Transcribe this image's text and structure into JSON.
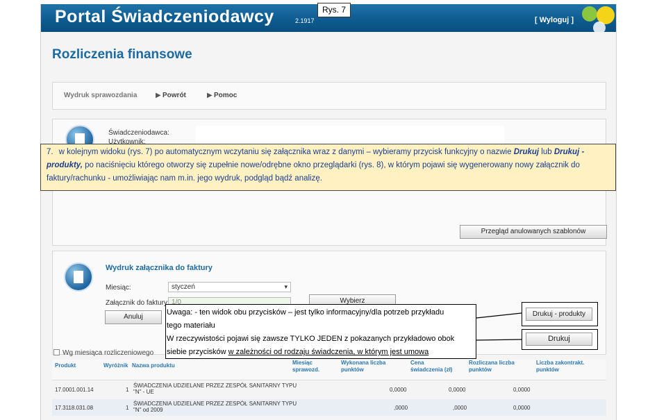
{
  "header": {
    "title": "Portal Świadczeniodawcy",
    "version": "2.1917",
    "logout": "[ Wyloguj ]",
    "brand_colors": [
      "#8ac640",
      "#f5d319",
      "#1f73a8"
    ]
  },
  "page": {
    "title": "Rozliczenia finansowe"
  },
  "toolbar": {
    "items": [
      {
        "label": "Wydruk sprawozdania",
        "active": false
      },
      {
        "label": "Powrót",
        "active": true
      },
      {
        "label": "Pomoc",
        "active": true
      }
    ]
  },
  "provider": {
    "label_provider": "Świadczeniodawca:",
    "label_user": "Użytkownik:",
    "btn_cancelled": "Przegląd anulowanych szablonów"
  },
  "wydruk": {
    "title": "Wydruk załącznika do faktury",
    "label_month": "Miesiąc:",
    "month_value": "styczeń",
    "label_attachment": "Załącznik do faktury:",
    "attachment_value": "1/0",
    "btn_select": "Wybierz",
    "btn_cancel": "Anuluj",
    "btn_print_products": "Drukuj - produkty",
    "btn_print": "Drukuj",
    "checkbox_label": "Wg miesiąca rozliczeniowego"
  },
  "table": {
    "headers": [
      "Produkt",
      "Wyróżnik",
      "Nazwa produktu",
      "Miesiąc sprawozd.",
      "Wykonana liczba punktów",
      "Cena świadczenia (zł)",
      "Rozliczana liczba punktów",
      "Liczba zakontrakt. punktów"
    ],
    "rows": [
      {
        "code": "17.0001.001.14",
        "flag": "1",
        "name_1": "ŚWIADCZENIA UDZIELANE PRZEZ ZESPÓŁ SANITARNY TYPU",
        "name_2": "\"N\" - UE",
        "v1": "0,0000",
        "v2": "0,0000",
        "v3": "0,0000"
      },
      {
        "code": "17.3118.031.08",
        "flag": "1",
        "name_1": "ŚWIADCZENIA UDZIELANE PRZEZ ZESPÓŁ SANITARNY TYPU",
        "name_2": "\"N\" od 2009",
        "v1": ",0000",
        "v2": ",0000",
        "v3": "0,0000"
      }
    ]
  },
  "annotations": {
    "figure_label": "Rys. 7",
    "step_number": "7.",
    "step_text_1": "w kolejnym widoku (rys. 7) po automatycznym wczytaniu się załącznika wraz z danymi – wybieramy przycisk funkcyjny o nazwie ",
    "step_bold_1": "Drukuj",
    "step_text_2": " lub ",
    "step_bold_2": "Drukuj - produkty,",
    "step_text_3": " po naciśnięciu którego otworzy się zupełnie nowe/odrębne okno przeglądarki (rys. 8), w którym pojawi się wygenerowany nowy załącznik do faktury/rachunku - umożliwiając nam m.in. jego wydruk, podgląd bądź analizę.",
    "warning_line1": "Uwaga: - ten widok obu przycisków – jest tylko informacyjny/dla potrzeb przykładu",
    "warning_line2": "tego materiału",
    "warning_line3": "W rzeczywistości pojawi się zawsze TYLKO JEDEN z pokazanych przykładowo obok",
    "warning_line4a": "siebie przycisków ",
    "warning_line4b": "w zależności od rodzaju świadczenia, w którym jest umowa"
  }
}
